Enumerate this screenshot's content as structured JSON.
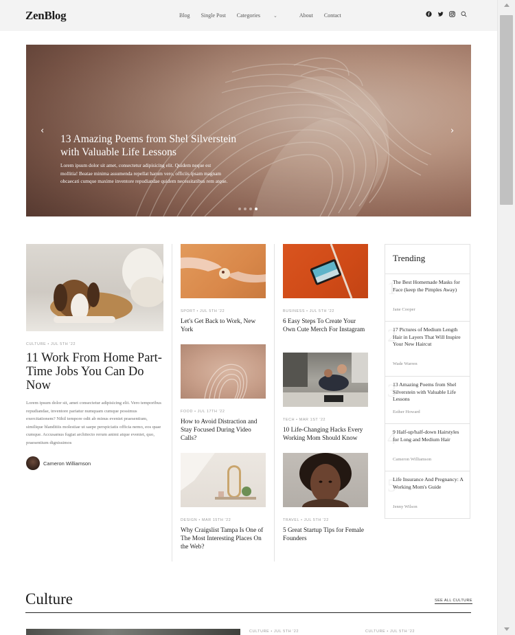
{
  "brand": {
    "logo": "ZenBlog"
  },
  "nav": {
    "items": [
      {
        "label": "Blog"
      },
      {
        "label": "Single Post"
      },
      {
        "label": "Categories",
        "dropdown": true
      },
      {
        "label": "About"
      },
      {
        "label": "Contact"
      }
    ],
    "social_icons": [
      "facebook-icon",
      "twitter-icon",
      "instagram-icon",
      "search-icon"
    ]
  },
  "hero": {
    "title": "13 Amazing Poems from Shel Silverstein with Valuable Life Lessons",
    "excerpt": "Lorem ipsum dolor sit amet, consectetur adipisicing elit. Quidem neque est mollitia! Beatae minima assumenda repellat harum vero, officiis ipsam magnam obcaecati cumque maxime inventore repudiandae quidem necessitatibus rem atque.",
    "prev_icon": "chevron-left-icon",
    "next_icon": "chevron-right-icon",
    "slides_total": 4,
    "active_slide": 4
  },
  "featured": {
    "meta": "CULTURE  •  JUL 5TH '22",
    "title": "11 Work From Home Part-Time Jobs You Can Do Now",
    "excerpt": "Lorem ipsum dolor sit, amet consectetur adipisicing elit. Vero temporibus repudiandae, inventore pariatur numquam cumque possimus exercitationem? Nihil tempore odit ab minus eveniet praesentium, similique blanditiis molestiae ut saepe perspiciatis officia nemo, eos quae cumque. Accusamus fugiat architecto rerum animi atque eveniet, quo, praesentium dignissimos",
    "author": "Cameron Williamson"
  },
  "posts_col1": [
    {
      "meta": "SPORT  •  JUL 5TH '22",
      "title": "Let's Get Back to Work, New York"
    },
    {
      "meta": "FOOD  •  JUL 17TH '22",
      "title": "How to Avoid Distraction and Stay Focused During Video Calls?"
    },
    {
      "meta": "DESIGN  •  MAR 15TH '22",
      "title": "Why Craigslist Tampa Is One of The Most Interesting Places On the Web?"
    }
  ],
  "posts_col2": [
    {
      "meta": "BUSINESS  •  JUL 5TH '22",
      "title": "6 Easy Steps To Create Your Own Cute Merch For Instagram"
    },
    {
      "meta": "TECH  •  MAR 1ST '22",
      "title": "10 Life-Changing Hacks Every Working Mom Should Know"
    },
    {
      "meta": "TRAVEL  •  JUL 5TH '22",
      "title": "5 Great Startup Tips for Female Founders"
    }
  ],
  "trending": {
    "heading": "Trending",
    "items": [
      {
        "num": "1",
        "title": "The Best Homemade Masks for Face (keep the Pimples Away)",
        "author": "Jane Cooper"
      },
      {
        "num": "2",
        "title": "17 Pictures of Medium Length Hair in Layers That Will Inspire Your New Haircut",
        "author": "Wade Warren"
      },
      {
        "num": "3",
        "title": "13 Amazing Poems from Shel Silverstein with Valuable Life Lessons",
        "author": "Esther Howard"
      },
      {
        "num": "4",
        "title": "9 Half-up/half-down Hairstyles for Long and Medium Hair",
        "author": "Cameron Williamson"
      },
      {
        "num": "5",
        "title": "Life Insurance And Pregnancy: A Working Mom's Guide",
        "author": "Jenny Wilson"
      }
    ]
  },
  "culture": {
    "heading": "Culture",
    "see_all": "SEE ALL CULTURE",
    "meta_a": "CULTURE  •  JUL 5TH '22",
    "meta_b": "CULTURE  •  JUL 5TH '22"
  }
}
